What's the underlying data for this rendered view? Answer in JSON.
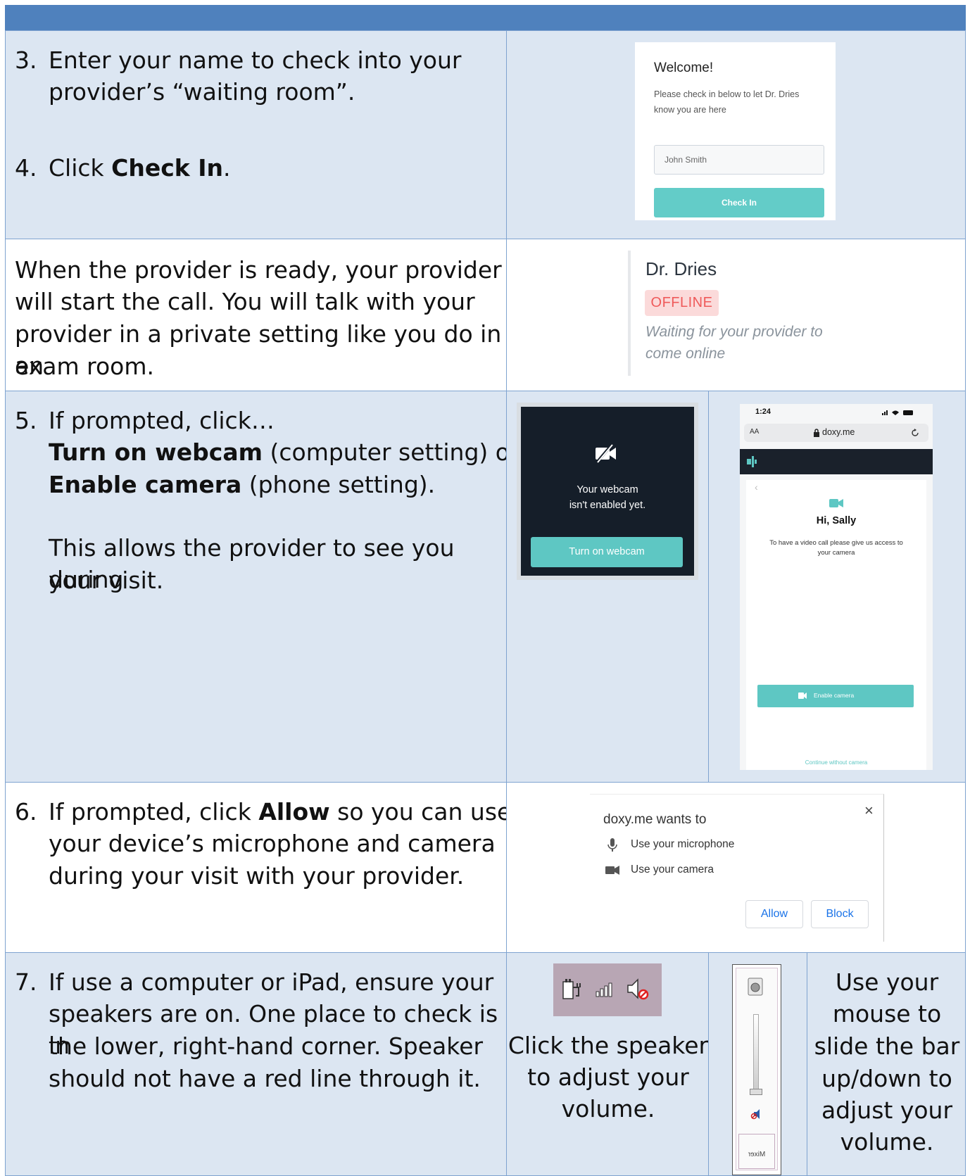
{
  "row1": {
    "step3_number": "3.",
    "step3_line1": "Enter your name to check into your",
    "step3_line2": "provider’s “waiting room”.",
    "step4_number": "4.",
    "step4_prefix": "Click ",
    "step4_bold": "Check In",
    "step4_suffix": ".",
    "card": {
      "title": "Welcome!",
      "body_line1": "Please check in below to let Dr. Dries",
      "body_line2": "know you are here",
      "input_value": "John Smith",
      "button_label": "Check In"
    }
  },
  "row2": {
    "line1": "When the provider is ready, your provider",
    "line2": "will start the call. You will talk with your",
    "line3": "provider in a private setting like you do in an",
    "line4": "exam room.",
    "provider_name": "Dr. Dries",
    "status_badge": "OFFLINE",
    "waiting_line1": "Waiting for your provider to",
    "waiting_line2": "come online",
    "status_color": "#ef5a5a"
  },
  "row3": {
    "number": "5.",
    "line1": "If prompted, click…",
    "line2_bold": "Turn on webcam",
    "line2_rest": " (computer setting) or",
    "line3_bold": "Enable camera",
    "line3_rest": " (phone setting).",
    "para_line1": "This allows the provider to see you during",
    "para_line2": "your visit.",
    "webcam_card": {
      "icon": "camera-off-icon",
      "text_line1": "Your webcam",
      "text_line2": "isn't enabled yet.",
      "button_label": "Turn on webcam"
    },
    "phone": {
      "time": "1:24",
      "text_size": "AA",
      "url": "doxy.me",
      "back_glyph": "‹",
      "greeting": "Hi, Sally",
      "message_line1": "To have a video call please give us access to",
      "message_line2": "your camera",
      "enable_button": "Enable camera",
      "continue_link": "Continue without camera"
    }
  },
  "row4": {
    "number": "6.",
    "line1_prefix": "If prompted, click ",
    "line1_bold": "Allow",
    "line1_suffix": " so you can use",
    "line2": "your device’s microphone and camera",
    "line3": "during your visit with your provider.",
    "dialog": {
      "title": "doxy.me wants to",
      "mic_label": "Use your microphone",
      "camera_label": "Use your camera",
      "allow": "Allow",
      "block": "Block",
      "close": "×"
    }
  },
  "row5": {
    "number": "7.",
    "line1": "If use a computer or iPad, ensure your",
    "line2": "speakers are on. One place to check is in",
    "line3": "the lower, right-hand corner. Speaker",
    "line4": "should not have a red line through it.",
    "speaker_caption_line1": "Click the speaker",
    "speaker_caption_line2": "to adjust your",
    "speaker_caption_line3": "volume.",
    "mixer_label": "Mixer",
    "slider_caption_line1": "Use your",
    "slider_caption_line2": "mouse to",
    "slider_caption_line3": "slide the bar",
    "slider_caption_line4": "up/down to",
    "slider_caption_line5": "adjust your",
    "slider_caption_line6": "volume.",
    "tray_background": "#b8a6b4"
  }
}
